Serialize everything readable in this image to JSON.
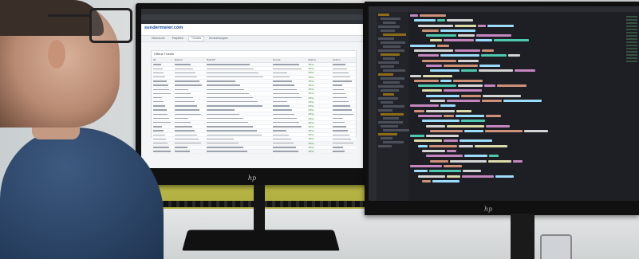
{
  "left_screen": {
    "app_logo": "sundermeier.com",
    "app_logo_sub": "",
    "nav_tabs": [
      {
        "label": "Übersicht"
      },
      {
        "label": "Projekte"
      },
      {
        "label": "Tickets"
      },
      {
        "label": "Einstellungen"
      }
    ],
    "panel_title": "Offene Tickets",
    "grid_headers": [
      "ID",
      "Datum",
      "Betreff",
      "Kunde",
      "Status",
      "Aktion"
    ],
    "row_count": 22,
    "status_value": "Offen"
  },
  "right_screen": {
    "editor_theme": "dark"
  },
  "brand_label": "hp",
  "colors": {
    "accent_blue": "#2a5ba8",
    "shirt": "#2b4466",
    "wall_green": "#b7b544",
    "editor_bg": "#1e1f24"
  }
}
